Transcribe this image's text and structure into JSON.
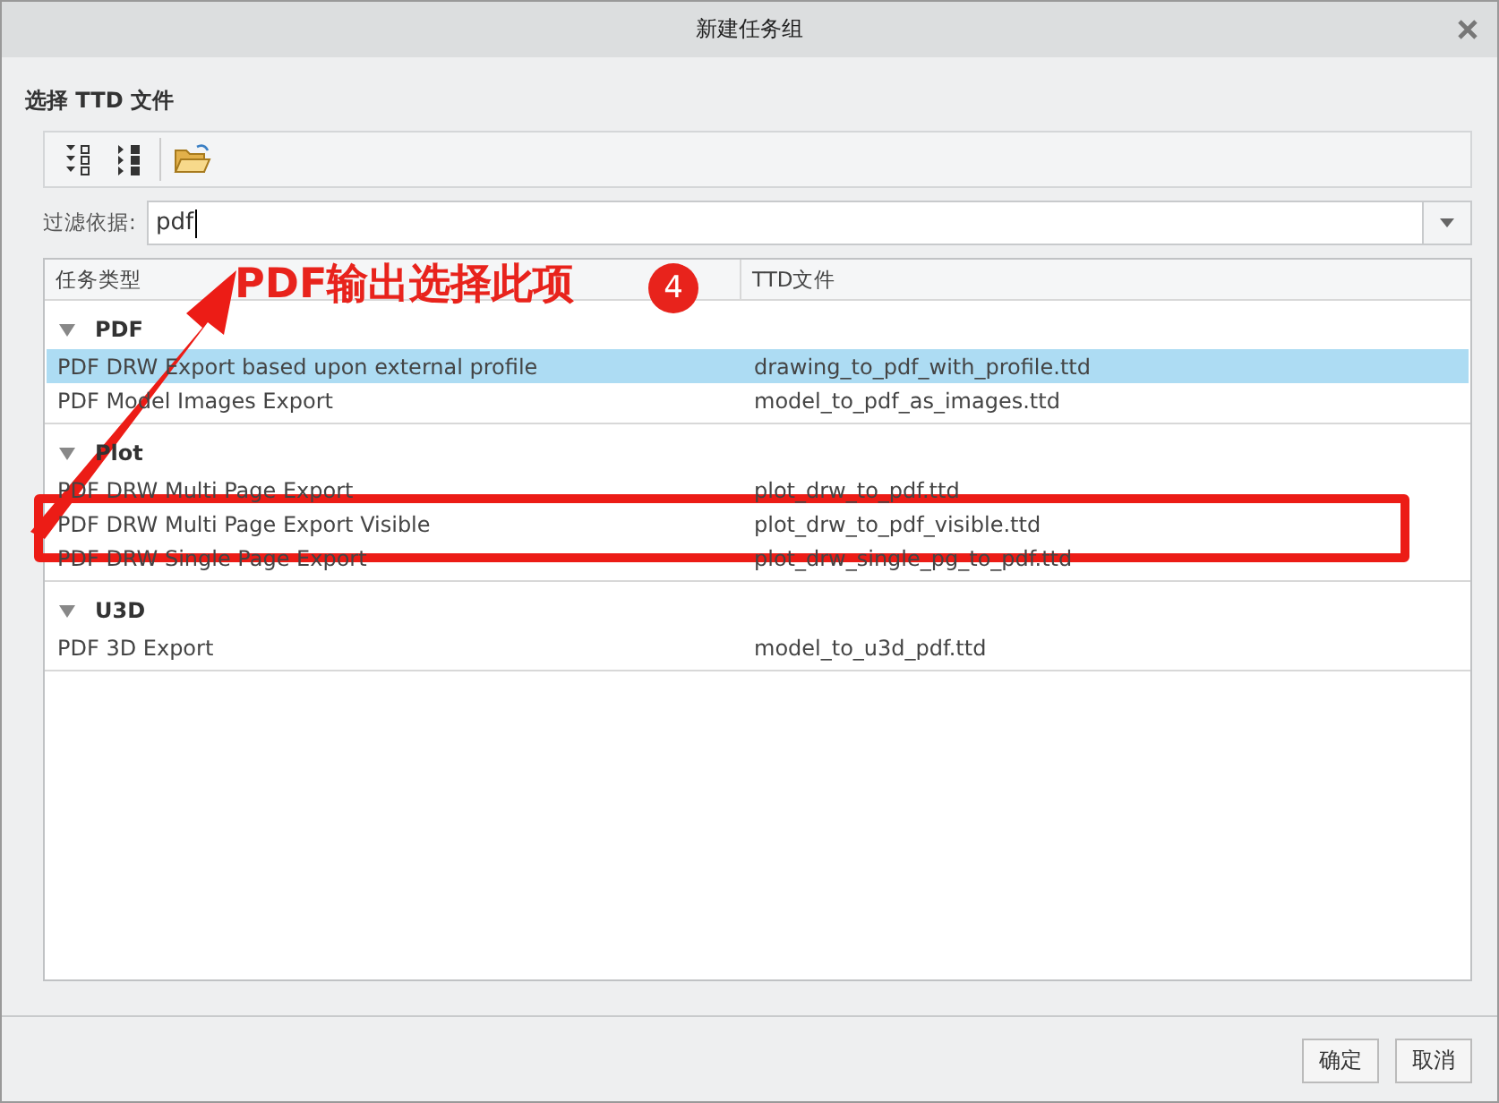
{
  "window": {
    "title": "新建任务组"
  },
  "section_title": "选择 TTD 文件",
  "filter": {
    "label": "过滤依据:",
    "value": "pdf"
  },
  "table": {
    "columns": [
      "任务类型",
      "TTD文件"
    ],
    "groups": [
      {
        "name": "PDF",
        "expanded": true,
        "rows": [
          {
            "task": "PDF DRW Export based upon external profile",
            "file": "drawing_to_pdf_with_profile.ttd",
            "selected": true
          },
          {
            "task": "PDF Model Images Export",
            "file": "model_to_pdf_as_images.ttd",
            "selected": false
          }
        ]
      },
      {
        "name": "Plot",
        "expanded": true,
        "rows": [
          {
            "task": "PDF DRW Multi Page Export",
            "file": "plot_drw_to_pdf.ttd",
            "selected": false
          },
          {
            "task": "PDF DRW Multi Page Export Visible",
            "file": "plot_drw_to_pdf_visible.ttd",
            "selected": false
          },
          {
            "task": "PDF DRW Single Page Export",
            "file": "plot_drw_single_pg_to_pdf.ttd",
            "selected": false
          }
        ]
      },
      {
        "name": "U3D",
        "expanded": true,
        "rows": [
          {
            "task": "PDF 3D Export",
            "file": "model_to_u3d_pdf.ttd",
            "selected": false
          }
        ]
      }
    ]
  },
  "annotation": {
    "text": "PDF输出选择此项",
    "step": "4"
  },
  "buttons": [
    "确定",
    "取消"
  ]
}
